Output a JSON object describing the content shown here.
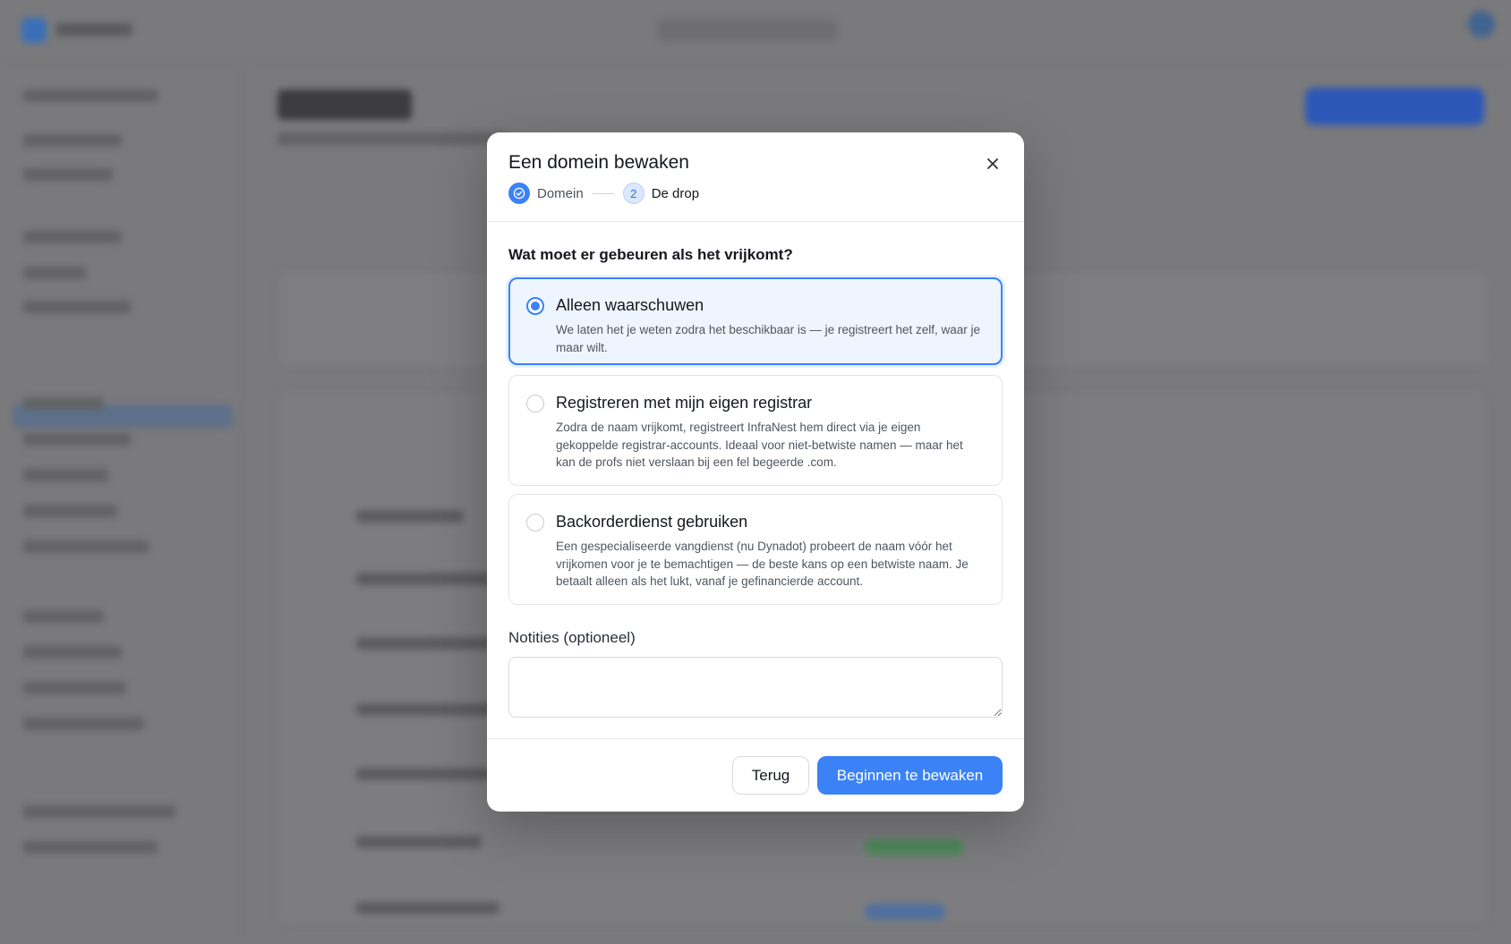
{
  "modal": {
    "title": "Een domein bewaken",
    "close_icon": "close-icon",
    "steps": [
      {
        "number": "1",
        "label": "Domein",
        "state": "completed",
        "icon": "check-circle-icon"
      },
      {
        "number": "2",
        "label": "De drop",
        "state": "current"
      }
    ],
    "question": "Wat moet er gebeuren als het vrijkomt?",
    "options": [
      {
        "title": "Alleen waarschuwen",
        "description": "We laten het je weten zodra het beschikbaar is — je registreert het zelf, waar je maar wilt.",
        "selected": true
      },
      {
        "title": "Registreren met mijn eigen registrar",
        "description": "Zodra de naam vrijkomt, registreert InfraNest hem direct via je eigen gekoppelde registrar-accounts. Ideaal voor niet-betwiste namen — maar het kan de profs niet verslaan bij een fel begeerde .com.",
        "selected": false
      },
      {
        "title": "Backorderdienst gebruiken",
        "description": "Een gespecialiseerde vangdienst (nu Dynadot) probeert de naam vóór het vrijkomen voor je te bemachtigen — de beste kans op een betwiste naam. Je betaalt alleen als het lukt, vanaf je gefinancierde account.",
        "selected": false
      }
    ],
    "notes": {
      "label": "Notities (optioneel)",
      "value": "",
      "placeholder": ""
    },
    "footer": {
      "back_label": "Terug",
      "submit_label": "Beginnen te bewaken"
    }
  },
  "colors": {
    "accent": "#3b82f6",
    "overlay": "#7a7a7c",
    "selected_bg": "#eef5ff"
  }
}
